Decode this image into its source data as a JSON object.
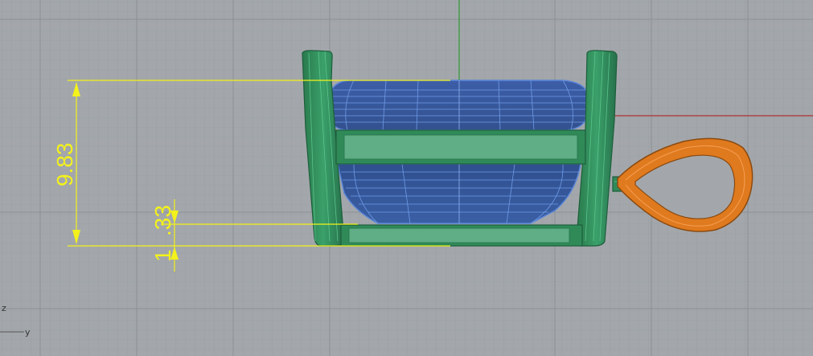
{
  "viewport": {
    "background": "#a3a7ab",
    "grid_minor_color": "#9aa0a5",
    "grid_major_color": "#8d9297",
    "x_axis_color": "#b03030",
    "z_axis_color": "#2f9a2f"
  },
  "dimensions": {
    "height_label": "9.83",
    "offset_label": "1.33",
    "color": "#f3f21a"
  },
  "axis_widget": {
    "vertical_label": "z",
    "horizontal_label": "y"
  },
  "model": {
    "gem_color": "#3a5fa6",
    "setting_color": "#2e8a58",
    "bail_color": "#e07a1e"
  }
}
